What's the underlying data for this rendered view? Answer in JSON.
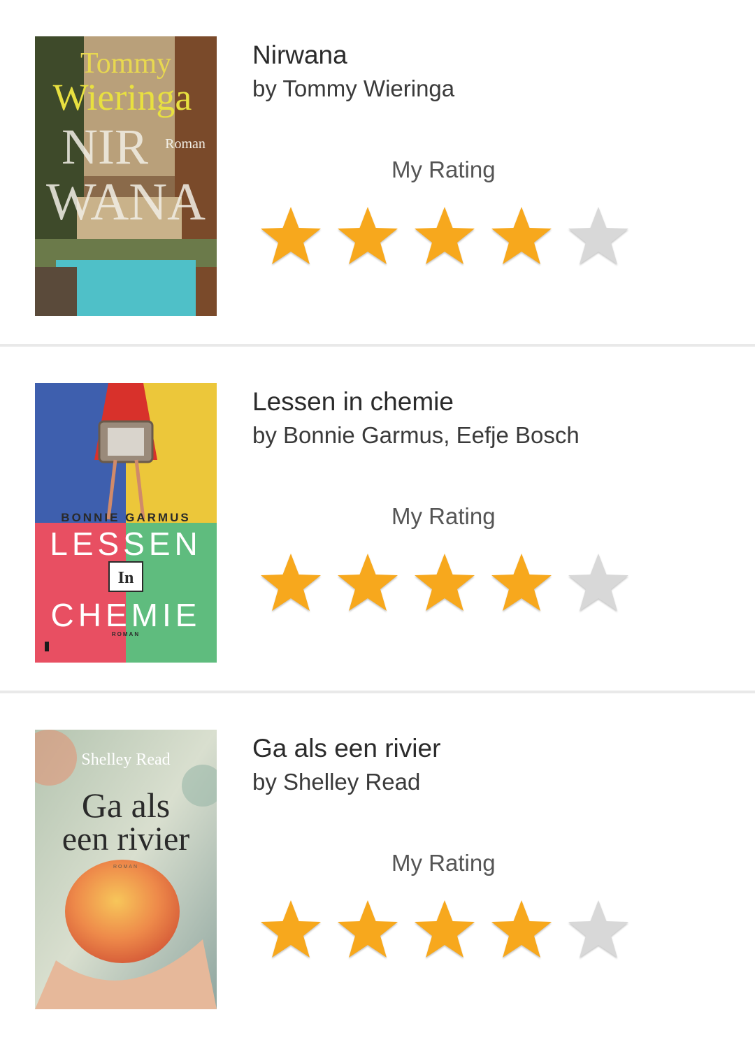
{
  "rating_label": "My Rating",
  "colors": {
    "star_filled": "#f7a81d",
    "star_empty": "#d8d8d8",
    "divider": "#e9e9e9"
  },
  "books": [
    {
      "title": "Nirwana",
      "author": "by Tommy Wieringa",
      "rating": 4,
      "max_rating": 5,
      "cover": {
        "lines": [
          "Tommy",
          "Wieringa",
          "NIR",
          "WANA",
          "Roman"
        ]
      }
    },
    {
      "title": "Lessen in chemie",
      "author": "by Bonnie Garmus, Eefje Bosch",
      "rating": 4,
      "max_rating": 5,
      "cover": {
        "lines": [
          "BONNIE GARMUS",
          "LESSEN",
          "In",
          "CHEMIE",
          "ROMAN"
        ]
      }
    },
    {
      "title": "Ga als een rivier",
      "author": "by Shelley Read",
      "rating": 4,
      "max_rating": 5,
      "cover": {
        "lines": [
          "Shelley Read",
          "Ga als",
          "een rivier",
          "ROMAN"
        ]
      }
    }
  ]
}
